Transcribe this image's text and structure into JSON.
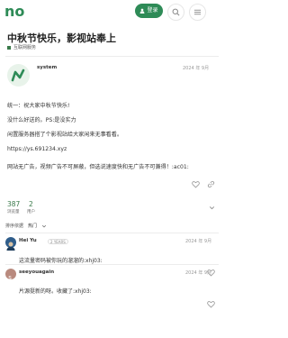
{
  "header": {
    "logo_text": "no",
    "login_label": "登录"
  },
  "topic": {
    "title": "中秋节快乐，影视站奉上",
    "category": "互联网服务"
  },
  "post": {
    "username": "system",
    "date": "2024 年 9月",
    "lines": [
      "统一：祝大家中秋节快乐!",
      "没什么好送的。PS:是没实力",
      "闲置服务器搭了个影视站给大家闲来无事看看。",
      "https://ys.691234.xyz",
      "网站无广告，视频广告不可屏蔽，但选说速度快和无广告不可兼得！:ac01:"
    ]
  },
  "stats": {
    "views": "387",
    "views_label": "浏览量",
    "users": "2",
    "users_label": "用户"
  },
  "sort": {
    "label": "排序依据",
    "selected": "热门"
  },
  "comments": [
    {
      "username": "Hei Yu",
      "badge": "2 YEARS",
      "date": "2024 年 9月",
      "text": "这流量密码被你玩的溜溜的:xhj03:"
    },
    {
      "username": "seeyouagain",
      "date": "2024 年 9月",
      "text": "片源挺新的呀。收藏了:xhj03:"
    }
  ],
  "colors": {
    "brand_green": "#2e8b57"
  }
}
